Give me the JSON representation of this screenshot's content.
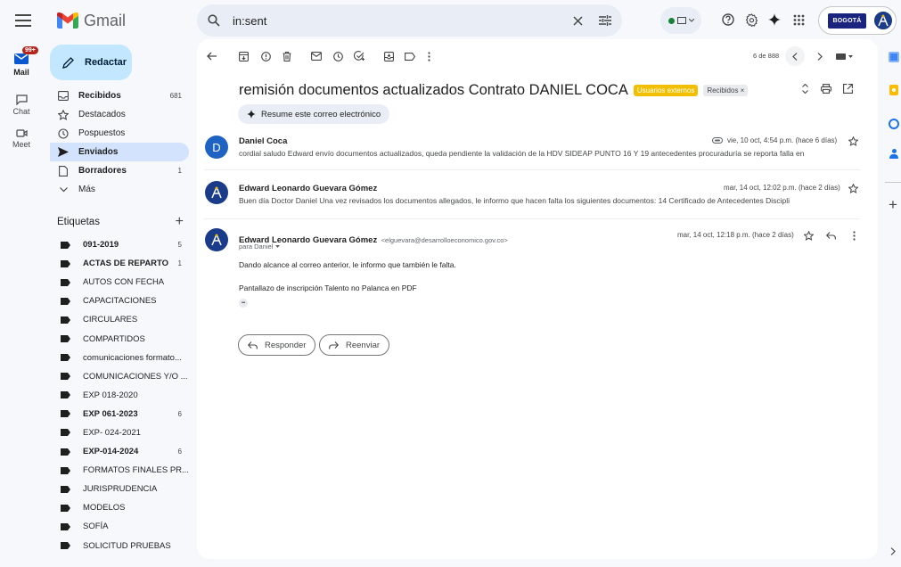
{
  "app": {
    "name": "Gmail",
    "search_query": "in:sent"
  },
  "account": {
    "org_logo_text": "BOGOTÁ"
  },
  "rail": {
    "mail_label": "Mail",
    "mail_badge": "99+",
    "chat_label": "Chat",
    "meet_label": "Meet"
  },
  "compose_label": "Redactar",
  "nav": [
    {
      "label": "Recibidos",
      "count": "681",
      "icon": "inbox-icon",
      "bold": true
    },
    {
      "label": "Destacados",
      "count": "",
      "icon": "star-icon",
      "bold": false
    },
    {
      "label": "Pospuestos",
      "count": "",
      "icon": "clock-icon",
      "bold": false
    },
    {
      "label": "Enviados",
      "count": "",
      "icon": "send-icon",
      "bold": true,
      "active": true
    },
    {
      "label": "Borradores",
      "count": "1",
      "icon": "draft-icon",
      "bold": true
    },
    {
      "label": "Más",
      "count": "",
      "icon": "chevron-down-icon",
      "bold": false
    }
  ],
  "labels_title": "Etiquetas",
  "labels": [
    {
      "name": "091-2019",
      "count": "5",
      "bold": true
    },
    {
      "name": "ACTAS DE REPARTO",
      "count": "1",
      "bold": true
    },
    {
      "name": "AUTOS CON FECHA",
      "count": "",
      "bold": false
    },
    {
      "name": "CAPACITACIONES",
      "count": "",
      "bold": false
    },
    {
      "name": "CIRCULARES",
      "count": "",
      "bold": false
    },
    {
      "name": "COMPARTIDOS",
      "count": "",
      "bold": false
    },
    {
      "name": "comunicaciones formato...",
      "count": "",
      "bold": false
    },
    {
      "name": "COMUNICACIONES Y/O ...",
      "count": "",
      "bold": false
    },
    {
      "name": "EXP 018-2020",
      "count": "",
      "bold": false
    },
    {
      "name": "EXP 061-2023",
      "count": "6",
      "bold": true
    },
    {
      "name": "EXP- 024-2021",
      "count": "",
      "bold": false
    },
    {
      "name": "EXP-014-2024",
      "count": "6",
      "bold": true
    },
    {
      "name": "FORMATOS FINALES PR...",
      "count": "",
      "bold": false
    },
    {
      "name": "JURISPRUDENCIA",
      "count": "",
      "bold": false
    },
    {
      "name": "MODELOS",
      "count": "",
      "bold": false
    },
    {
      "name": "SOFÍA",
      "count": "",
      "bold": false
    },
    {
      "name": "SOLICITUD PRUEBAS",
      "count": "",
      "bold": false
    }
  ],
  "thread": {
    "pager": "6 de 888",
    "subject": "remisión documentos actualizados Contrato DANIEL COCA",
    "chip_external": "Usuarios externos",
    "chip_inbox": "Recibidos ×",
    "summarize_label": "Resume este correo electrónico"
  },
  "messages": [
    {
      "sender": "Daniel Coca",
      "avatar_letter": "D",
      "date": "vie, 10 oct, 4:54 p.m. (hace 6 días)",
      "snippet": "cordial saludo Edward envío documentos actualizados, queda pendiente la validación de la HDV SIDEAP PUNTO 16 Y 19 antecedentes procuraduría se reporta falla en"
    },
    {
      "sender": "Edward Leonardo Guevara Gómez",
      "date": "mar, 14 oct, 12:02 p.m. (hace 2 días)",
      "snippet": "Buen día Doctor Daniel Una vez revisados los documentos allegados, le informo que hacen falta los siguientes documentos: 14 Certificado de Antecedentes Discipli"
    },
    {
      "sender": "Edward Leonardo Guevara Gómez",
      "email": "<elguevara@desarrolloeconomico.gov.co>",
      "to": "para Daniel",
      "date": "mar, 14 oct, 12:18 p.m. (hace 2 días)",
      "body_line1": "Dando alcance al correo anterior, le informo que también le falta.",
      "body_line2": "Pantallazo de inscripción Talento no Palanca en PDF",
      "ellipsis": "•••"
    }
  ],
  "actions": {
    "reply": "Responder",
    "forward": "Reenviar"
  }
}
